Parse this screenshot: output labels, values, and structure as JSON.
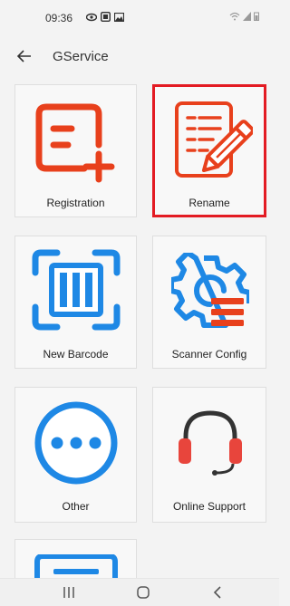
{
  "status": {
    "time": "09:36"
  },
  "appbar": {
    "title": "GService"
  },
  "tiles": [
    {
      "label": "Registration",
      "icon": "registration-icon",
      "selected": false
    },
    {
      "label": "Rename",
      "icon": "rename-document-icon",
      "selected": true
    },
    {
      "label": "New Barcode",
      "icon": "barcode-icon",
      "selected": false
    },
    {
      "label": "Scanner Config",
      "icon": "gear-config-icon",
      "selected": false
    },
    {
      "label": "Other",
      "icon": "more-dots-icon",
      "selected": false
    },
    {
      "label": "Online Support",
      "icon": "headset-icon",
      "selected": false
    }
  ],
  "colors": {
    "accent_red": "#e8401c",
    "accent_blue": "#1e88e5",
    "selection_border": "#e31b23"
  }
}
